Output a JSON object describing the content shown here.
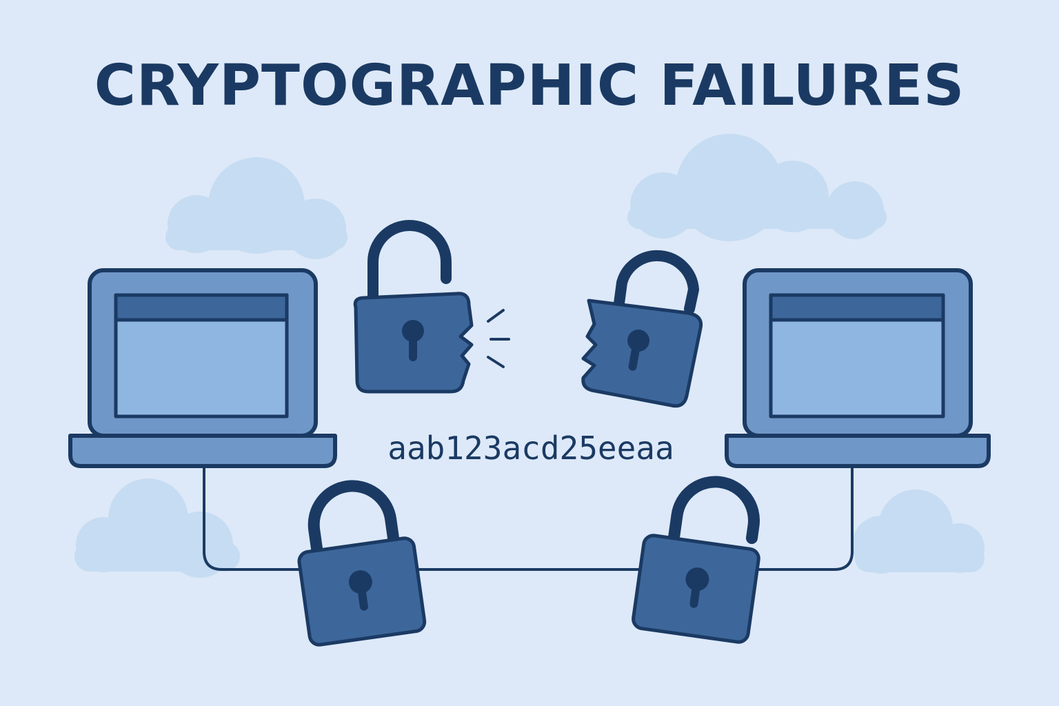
{
  "header": {
    "title": "CRYPTOGRAPHIC FAILURES"
  },
  "ciphertext": {
    "text": "aab123acd25eeaa"
  },
  "colors": {
    "background": "#dde9f8",
    "cloud": "#c6dcf2",
    "outline": "#1b3a63",
    "lock_body": "#3d679b",
    "laptop_frame": "#6f97c7",
    "laptop_screen": "#8fb6e0",
    "laptop_bar": "#3d679b",
    "title": "#1b3a63"
  },
  "icons": {
    "clouds": "cloud-icon",
    "laptops": "laptop-icon",
    "broken_locks": "broken-padlock-icon",
    "locks": "padlock-icon",
    "unlocked": "open-padlock-icon"
  }
}
